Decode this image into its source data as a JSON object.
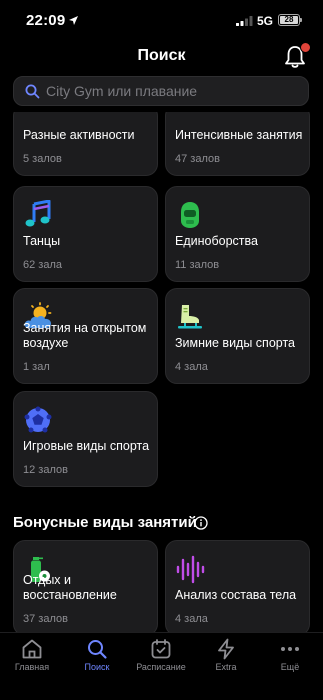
{
  "status_bar": {
    "time": "22:09",
    "network": "5G",
    "battery": "28"
  },
  "header": {
    "title": "Поиск"
  },
  "search": {
    "placeholder": "City Gym или плавание"
  },
  "categories": [
    {
      "title": "Разные активности",
      "subtitle": "5 залов",
      "icon": "mixed-activities-icon"
    },
    {
      "title": "Интенсивные занятия",
      "subtitle": "47 залов",
      "icon": "intensive-training-icon"
    },
    {
      "title": "Танцы",
      "subtitle": "62 зала",
      "icon": "music-note-icon"
    },
    {
      "title": "Единоборства",
      "subtitle": "11 залов",
      "icon": "boxing-helmet-icon"
    },
    {
      "title": "Занятия на открытом воздухе",
      "subtitle": "1 зал",
      "icon": "sun-cloud-icon"
    },
    {
      "title": "Зимние виды спорта",
      "subtitle": "4 зала",
      "icon": "ice-skate-icon"
    },
    {
      "title": "Игровые виды спорта",
      "subtitle": "12 залов",
      "icon": "game-ball-icon"
    }
  ],
  "bonus_section": {
    "title": "Бонусные виды занятий"
  },
  "bonus_categories": [
    {
      "title": "Отдых и восстановление",
      "subtitle": "37 залов",
      "icon": "relaxation-bottle-icon"
    },
    {
      "title": "Анализ состава тела",
      "subtitle": "4 зала",
      "icon": "body-analysis-wave-icon"
    }
  ],
  "tabbar": {
    "items": [
      {
        "label": "Главная",
        "icon": "home-icon",
        "active": false
      },
      {
        "label": "Поиск",
        "icon": "search-icon",
        "active": true
      },
      {
        "label": "Расписание",
        "icon": "calendar-icon",
        "active": false
      },
      {
        "label": "Extra",
        "icon": "lightning-icon",
        "active": false
      },
      {
        "label": "Ещё",
        "icon": "more-dots-icon",
        "active": false
      }
    ]
  },
  "colors": {
    "background": "#000000",
    "card": "#1c1c1e",
    "accent": "#6f86ff",
    "muted": "#8e8e93",
    "badge": "#e0443a"
  }
}
